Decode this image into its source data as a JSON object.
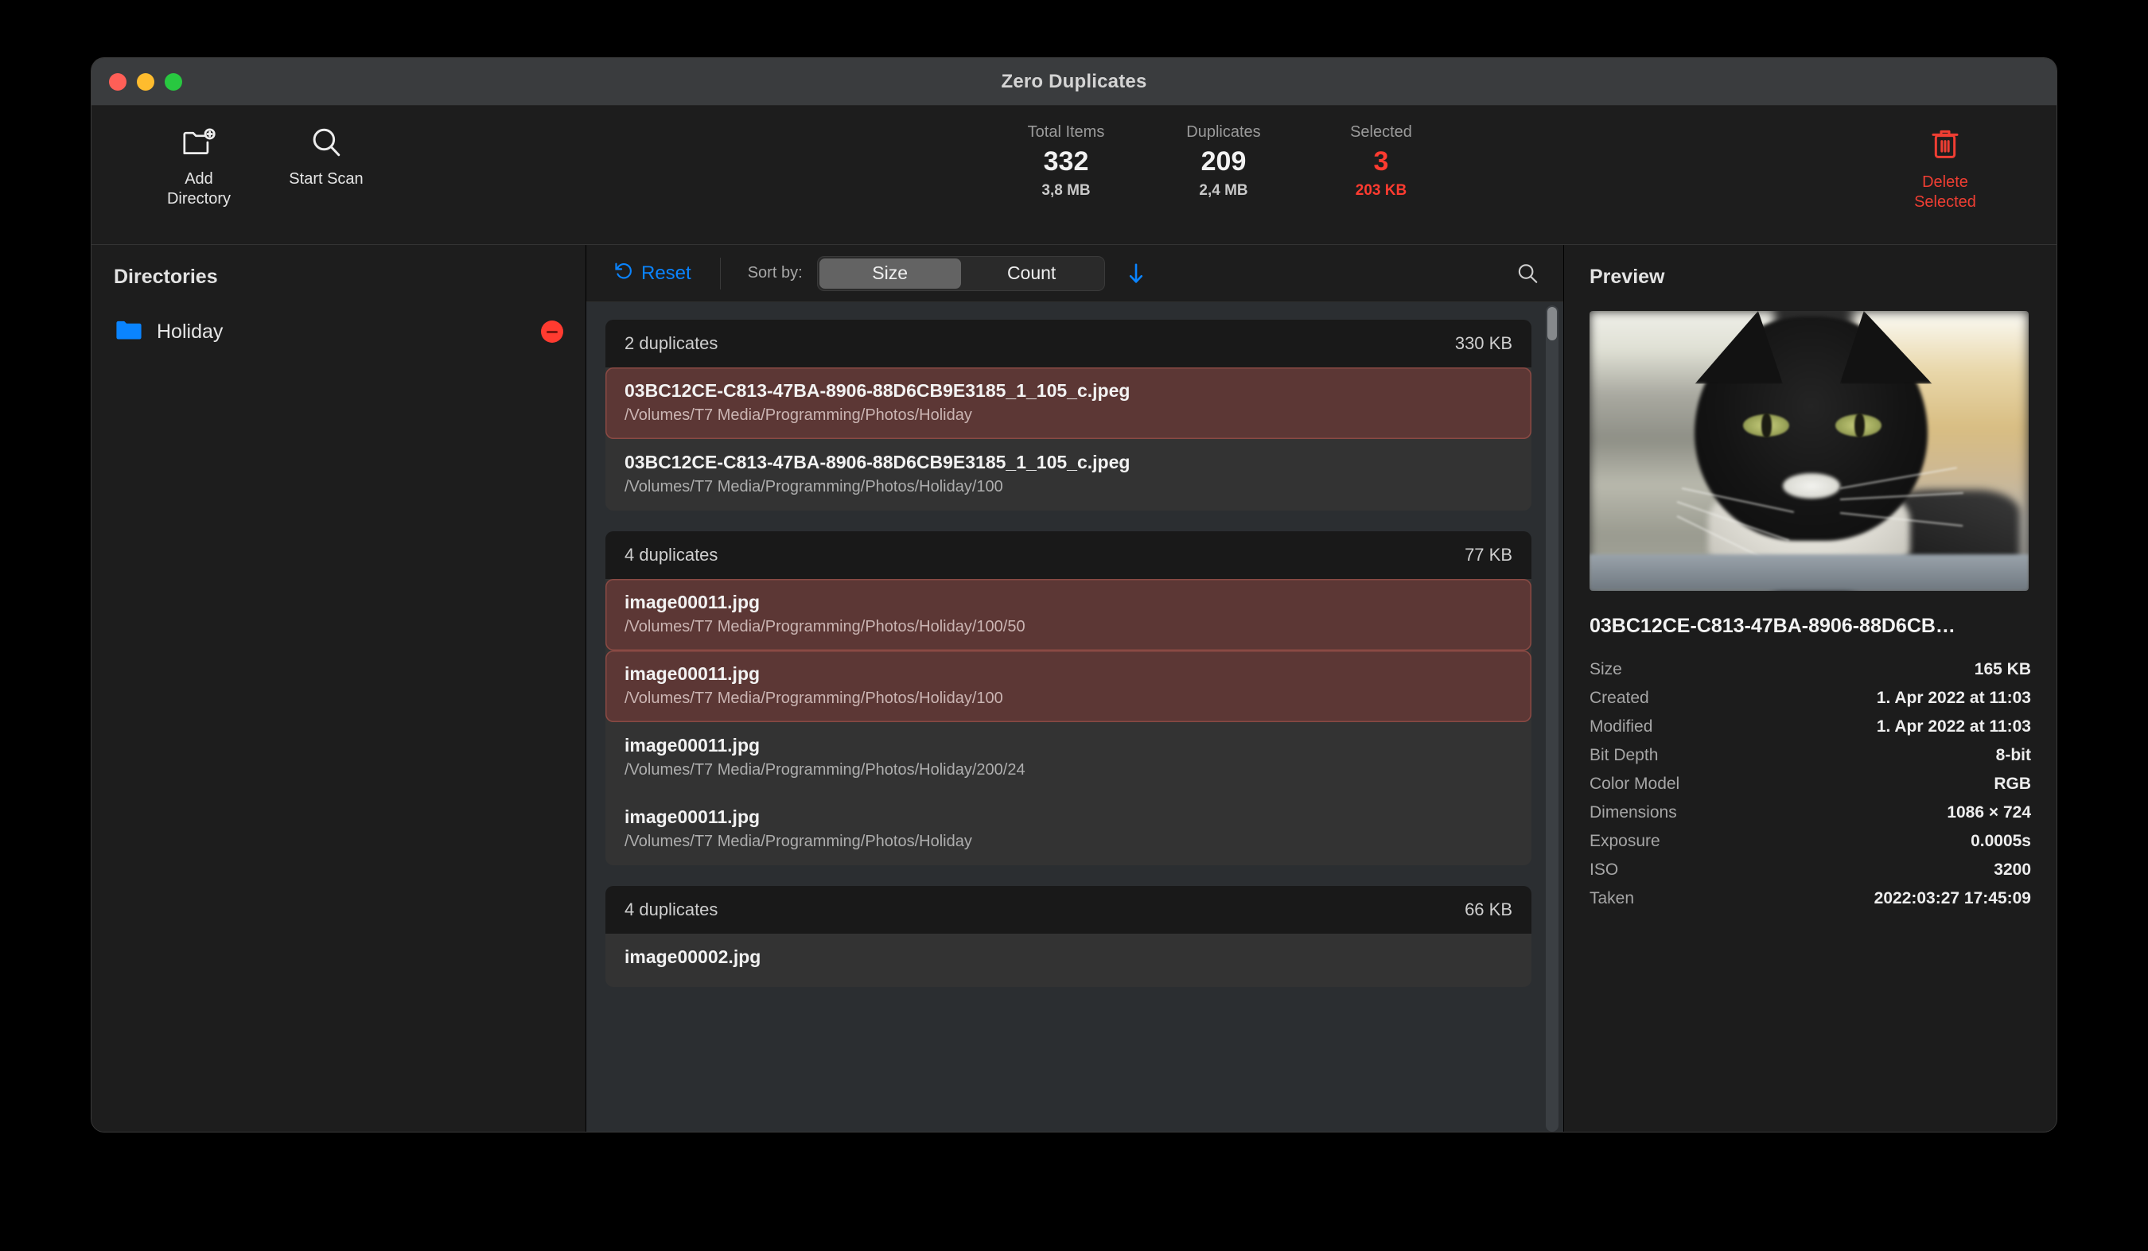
{
  "window": {
    "title": "Zero Duplicates"
  },
  "toolbar": {
    "add_directory": "Add\nDirectory",
    "add_directory_label": "Add Directory",
    "start_scan_label": "Start Scan",
    "delete_selected_label": "Delete Selected",
    "icons": {
      "add": "folder-plus-icon",
      "scan": "magnifier-icon",
      "delete": "trash-icon"
    },
    "stats": [
      {
        "label": "Total Items",
        "value": "332",
        "sub": "3,8 MB",
        "danger": false
      },
      {
        "label": "Duplicates",
        "value": "209",
        "sub": "2,4 MB",
        "danger": false
      },
      {
        "label": "Selected",
        "value": "3",
        "sub": "203 KB",
        "danger": true
      }
    ]
  },
  "sidebar": {
    "heading": "Directories",
    "items": [
      {
        "name": "Holiday"
      }
    ]
  },
  "sortbar": {
    "reset_label": "Reset",
    "sort_by_label": "Sort by:",
    "segments": [
      "Size",
      "Count"
    ],
    "selected_segment": "Size",
    "direction": "descending"
  },
  "groups": [
    {
      "count_label": "2 duplicates",
      "size_label": "330 KB",
      "files": [
        {
          "name": "03BC12CE-C813-47BA-8906-88D6CB9E3185_1_105_c.jpeg",
          "path": "/Volumes/T7 Media/Programming/Photos/Holiday",
          "selected": true
        },
        {
          "name": "03BC12CE-C813-47BA-8906-88D6CB9E3185_1_105_c.jpeg",
          "path": "/Volumes/T7 Media/Programming/Photos/Holiday/100",
          "selected": false
        }
      ]
    },
    {
      "count_label": "4 duplicates",
      "size_label": "77 KB",
      "files": [
        {
          "name": "image00011.jpg",
          "path": "/Volumes/T7 Media/Programming/Photos/Holiday/100/50",
          "selected": true
        },
        {
          "name": "image00011.jpg",
          "path": "/Volumes/T7 Media/Programming/Photos/Holiday/100",
          "selected": true
        },
        {
          "name": "image00011.jpg",
          "path": "/Volumes/T7 Media/Programming/Photos/Holiday/200/24",
          "selected": false
        },
        {
          "name": "image00011.jpg",
          "path": "/Volumes/T7 Media/Programming/Photos/Holiday",
          "selected": false
        }
      ]
    },
    {
      "count_label": "4 duplicates",
      "size_label": "66 KB",
      "files": [
        {
          "name": "image00002.jpg",
          "path": "",
          "selected": false
        }
      ]
    }
  ],
  "preview": {
    "heading": "Preview",
    "image_alt": "black-and-white-cat-photo",
    "filename": "03BC12CE-C813-47BA-8906-88D6CB…",
    "metadata": [
      {
        "key": "Size",
        "value": "165 KB"
      },
      {
        "key": "Created",
        "value": "1. Apr 2022 at 11:03"
      },
      {
        "key": "Modified",
        "value": "1. Apr 2022 at 11:03"
      },
      {
        "key": "Bit Depth",
        "value": "8-bit"
      },
      {
        "key": "Color Model",
        "value": "RGB"
      },
      {
        "key": "Dimensions",
        "value": "1086 × 724"
      },
      {
        "key": "Exposure",
        "value": "0.0005s"
      },
      {
        "key": "ISO",
        "value": "3200"
      },
      {
        "key": "Taken",
        "value": "2022:03:27 17:45:09"
      }
    ]
  },
  "colors": {
    "accent_blue": "#0a84ff",
    "danger_red": "#ff3b30",
    "selection_red": "#5c3735",
    "folder_blue": "#0a84ff",
    "window_bg": "#1d1d1d",
    "list_bg": "#2b2e31"
  }
}
